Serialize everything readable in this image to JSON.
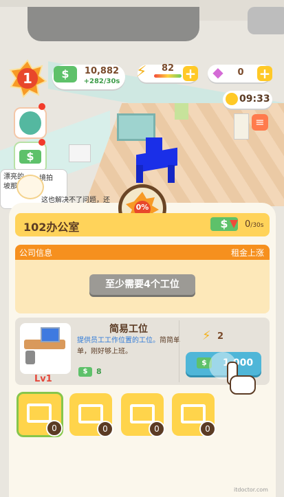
{
  "hud": {
    "level": "1",
    "money": "10,882",
    "money_rate": "+282/30s",
    "energy": "82",
    "gems": "0",
    "timer": "09:33",
    "money_icon": "dollar-icon",
    "gem_icon": "diamond-icon"
  },
  "bubble": {
    "text_lines": [
      "漂亮的",
      "坡那",
      "这也解决不了问题，还"
    ],
    "text_right": "境拍"
  },
  "progress": {
    "percent_label": "0%",
    "value": 0
  },
  "panel": {
    "office_name": "102办公室",
    "rent_value": "0",
    "rent_unit": "/30s",
    "info_title": "公司信息",
    "info_right": "租金上涨",
    "requirement": "至少需要4个工位"
  },
  "item": {
    "name": "简易工位",
    "desc_highlight": "提供员工工作位置的工位。",
    "desc_rest": "简简单单，刚好够上班。",
    "level": "Lv1",
    "income": "8",
    "energy_cost": "2",
    "price": "1,000"
  },
  "slots": [
    {
      "count": "0",
      "selected": true
    },
    {
      "count": "0",
      "selected": false
    },
    {
      "count": "0",
      "selected": false
    },
    {
      "count": "0",
      "selected": false
    }
  ],
  "colors": {
    "accent_orange": "#f6901e",
    "money_green": "#5ec16a",
    "gold": "#ffd35a",
    "blue_button": "#4fb6d8"
  },
  "watermark": "itdoctor.com"
}
